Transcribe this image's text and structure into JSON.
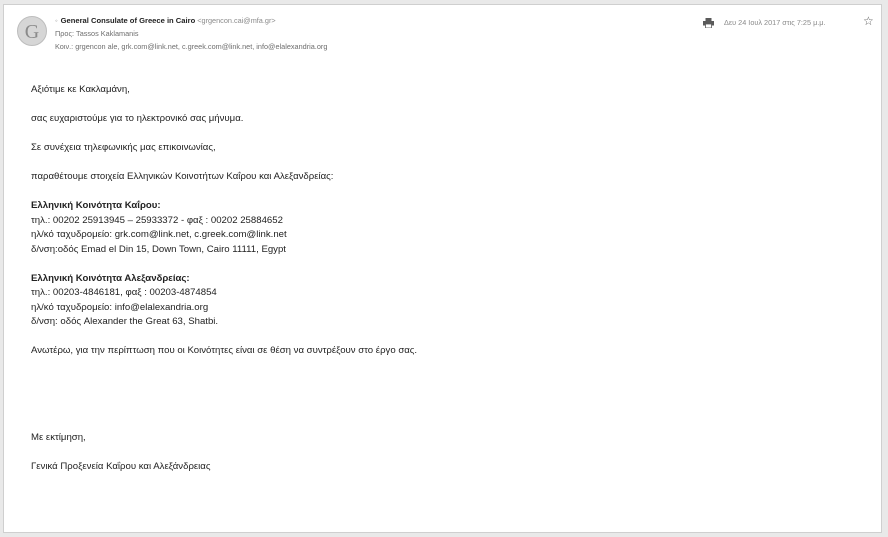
{
  "header": {
    "avatar_letter": "G",
    "sender_name": "General Consulate of Greece in Cairo",
    "sender_email": "<grgencon.cai@mfa.gr>",
    "to_line": "Προς: Tassos Kaklamanis",
    "cc_line": "Κοιν.: grgencon ale,  grk.com@link.net,  c.greek.com@link.net,  info@elalexandria.org",
    "date": "Δευ 24 Ιουλ 2017 στις 7:25 μ.μ.",
    "icons": [
      "print-icon",
      "star-icon"
    ]
  },
  "body": {
    "greeting": "Αξιότιμε κε Κακλαμάνη,",
    "line1": "σας ευχαριστούμε για το ηλεκτρονικό σας μήνυμα.",
    "line2": "Σε συνέχεια τηλεφωνικής μας επικοινωνίας,",
    "line3": "παραθέτουμε στοιχεία Ελληνικών Κοινοτήτων Καΐρου και Αλεξανδρείας:",
    "cairo": {
      "title": "Ελληνική Κοινότητα Καΐρου:",
      "phone": "τηλ.: 00202 25913945 – 25933372 - φαξ : 00202 25884652",
      "email": "ηλ/κό ταχυδρομείο: grk.com@link.net, c.greek.com@link.net",
      "address": "δ/νση:οδός Emad el Din 15, Down Town, Cairo 11111, Egypt"
    },
    "alexandria": {
      "title": "Ελληνική Κοινότητα Αλεξανδρείας:",
      "phone": "τηλ.: 00203-4846181, φαξ : 00203-4874854",
      "email": "ηλ/κό ταχυδρομείο: info@elalexandria.org",
      "address": "δ/νση: οδός Alexander the Great 63, Shatbi."
    },
    "line4": "Ανωτέρω, για την περίπτωση που οι Κοινότητες είναι σε θέση να συντρέξουν στο έργο σας.",
    "closing": "Με εκτίμηση,",
    "signature": "Γενικά Προξενεία Καΐρου και Αλεξάνδρειας"
  }
}
